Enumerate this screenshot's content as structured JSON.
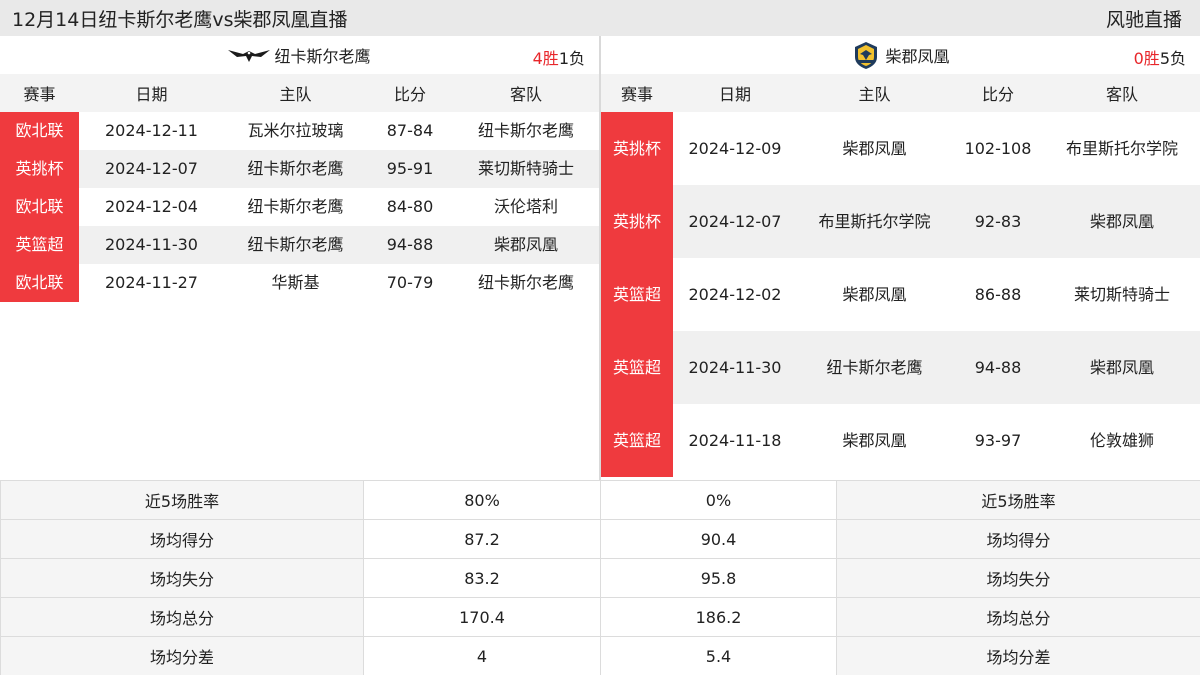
{
  "header": {
    "title": "12月14日纽卡斯尔老鹰vs柴郡凤凰直播",
    "site": "风驰直播"
  },
  "left": {
    "team": "纽卡斯尔老鹰",
    "logo_icon": "eagle-logo-icon",
    "record_win": "4胜",
    "record_lose": "1负",
    "columns": [
      "赛事",
      "日期",
      "主队",
      "比分",
      "客队"
    ],
    "rows": [
      {
        "comp": "欧北联",
        "date": "2024-12-11",
        "home": "瓦米尔拉玻璃",
        "score": "87-84",
        "away": "纽卡斯尔老鹰"
      },
      {
        "comp": "英挑杯",
        "date": "2024-12-07",
        "home": "纽卡斯尔老鹰",
        "score": "95-91",
        "away": "莱切斯特骑士"
      },
      {
        "comp": "欧北联",
        "date": "2024-12-04",
        "home": "纽卡斯尔老鹰",
        "score": "84-80",
        "away": "沃伦塔利"
      },
      {
        "comp": "英篮超",
        "date": "2024-11-30",
        "home": "纽卡斯尔老鹰",
        "score": "94-88",
        "away": "柴郡凤凰"
      },
      {
        "comp": "欧北联",
        "date": "2024-11-27",
        "home": "华斯基",
        "score": "70-79",
        "away": "纽卡斯尔老鹰"
      }
    ]
  },
  "right": {
    "team": "柴郡凤凰",
    "logo_icon": "phoenix-logo-icon",
    "record_win": "0胜",
    "record_lose": "5负",
    "columns": [
      "赛事",
      "日期",
      "主队",
      "比分",
      "客队"
    ],
    "rows": [
      {
        "comp": "英挑杯",
        "date": "2024-12-09",
        "home": "柴郡凤凰",
        "score": "102-108",
        "away": "布里斯托尔学院"
      },
      {
        "comp": "英挑杯",
        "date": "2024-12-07",
        "home": "布里斯托尔学院",
        "score": "92-83",
        "away": "柴郡凤凰"
      },
      {
        "comp": "英篮超",
        "date": "2024-12-02",
        "home": "柴郡凤凰",
        "score": "86-88",
        "away": "莱切斯特骑士"
      },
      {
        "comp": "英篮超",
        "date": "2024-11-30",
        "home": "纽卡斯尔老鹰",
        "score": "94-88",
        "away": "柴郡凤凰"
      },
      {
        "comp": "英篮超",
        "date": "2024-11-18",
        "home": "柴郡凤凰",
        "score": "93-97",
        "away": "伦敦雄狮"
      }
    ]
  },
  "stats": [
    {
      "label": "近5场胜率",
      "left": "80%",
      "right": "0%"
    },
    {
      "label": "场均得分",
      "left": "87.2",
      "right": "90.4"
    },
    {
      "label": "场均失分",
      "left": "83.2",
      "right": "95.8"
    },
    {
      "label": "场均总分",
      "left": "170.4",
      "right": "186.2"
    },
    {
      "label": "场均分差",
      "left": "4",
      "right": "5.4"
    }
  ],
  "colors": {
    "accent_red": "#ef3a3e",
    "win_red": "#e8262a",
    "header_bg": "#e9e9e9"
  }
}
